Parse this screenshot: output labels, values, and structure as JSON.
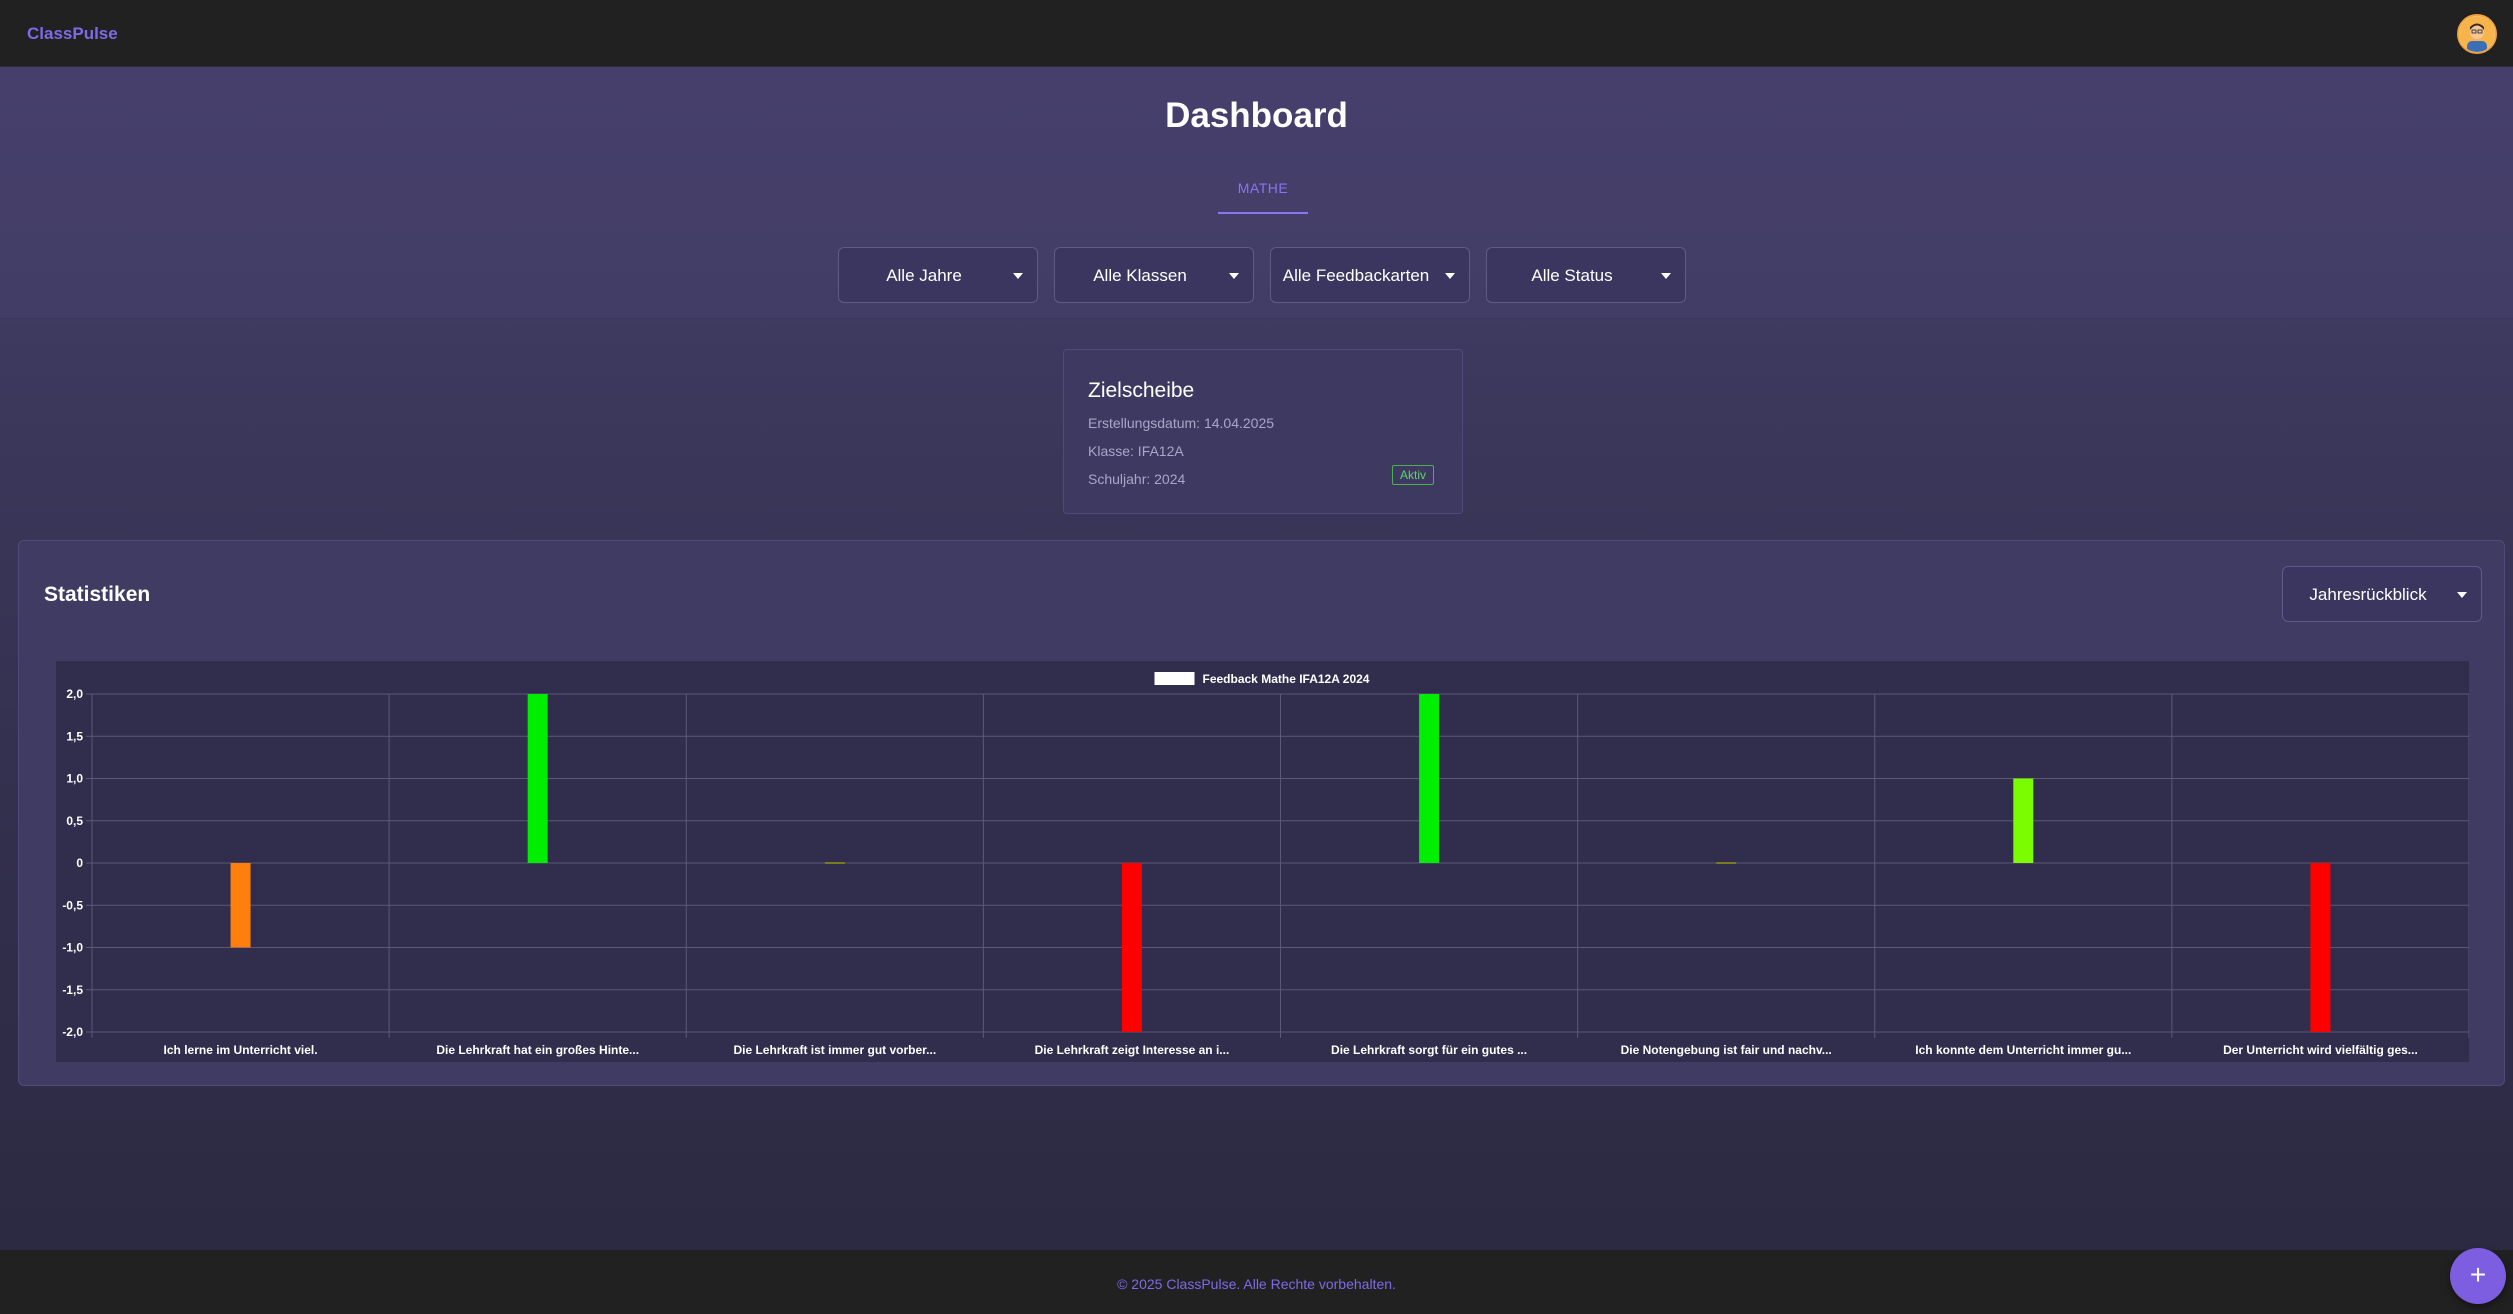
{
  "app": {
    "brand": "ClassPulse"
  },
  "header": {
    "title": "Dashboard",
    "tabs": [
      {
        "label": "MATHE",
        "active": true
      }
    ]
  },
  "filters": [
    {
      "label": "Alle Jahre"
    },
    {
      "label": "Alle Klassen"
    },
    {
      "label": "Alle Feedbackarten"
    },
    {
      "label": "Alle Status"
    }
  ],
  "card": {
    "title": "Zielscheibe",
    "date": "Erstellungsdatum: 14.04.2025",
    "class": "Klasse: IFA12A",
    "year": "Schuljahr: 2024",
    "status": "Aktiv"
  },
  "stats": {
    "title": "Statistiken",
    "period_label": "Jahresrückblick"
  },
  "chart_data": {
    "type": "bar",
    "title": "",
    "legend": [
      "Feedback Mathe IFA12A 2024"
    ],
    "legend_placement": "top-center",
    "categories": [
      "Ich lerne im Unterricht viel.",
      "Die Lehrkraft hat ein großes Hinte...",
      "Die Lehrkraft ist immer gut vorber...",
      "Die Lehrkraft zeigt Interesse an i...",
      "Die Lehrkraft sorgt für ein gutes ...",
      "Die Notengebung ist fair und nachv...",
      "Ich konnte dem Unterricht immer gu...",
      "Der Unterricht wird vielfältig ges..."
    ],
    "series": [
      {
        "name": "Feedback Mathe IFA12A 2024",
        "values": [
          -1,
          2,
          0,
          -2,
          2,
          0,
          1,
          -2
        ],
        "colors": [
          "#ff7f0e",
          "#00ee00",
          "#7a7a20",
          "#ff0000",
          "#00ee00",
          "#7a7a20",
          "#7cfc00",
          "#ff0000"
        ]
      }
    ],
    "ylim": [
      -2,
      2
    ],
    "y_ticks": [
      "2,0",
      "1,5",
      "1,0",
      "0,5",
      "0",
      "-0,5",
      "-1,0",
      "-1,5",
      "-2,0"
    ],
    "grid": true
  },
  "footer": {
    "text": "© 2025 ClassPulse. Alle Rechte vorbehalten."
  },
  "fab": {
    "label": "+"
  },
  "icons": {
    "avatar": "user-avatar-icon",
    "caret": "caret-down-icon",
    "fab": "plus-icon"
  }
}
